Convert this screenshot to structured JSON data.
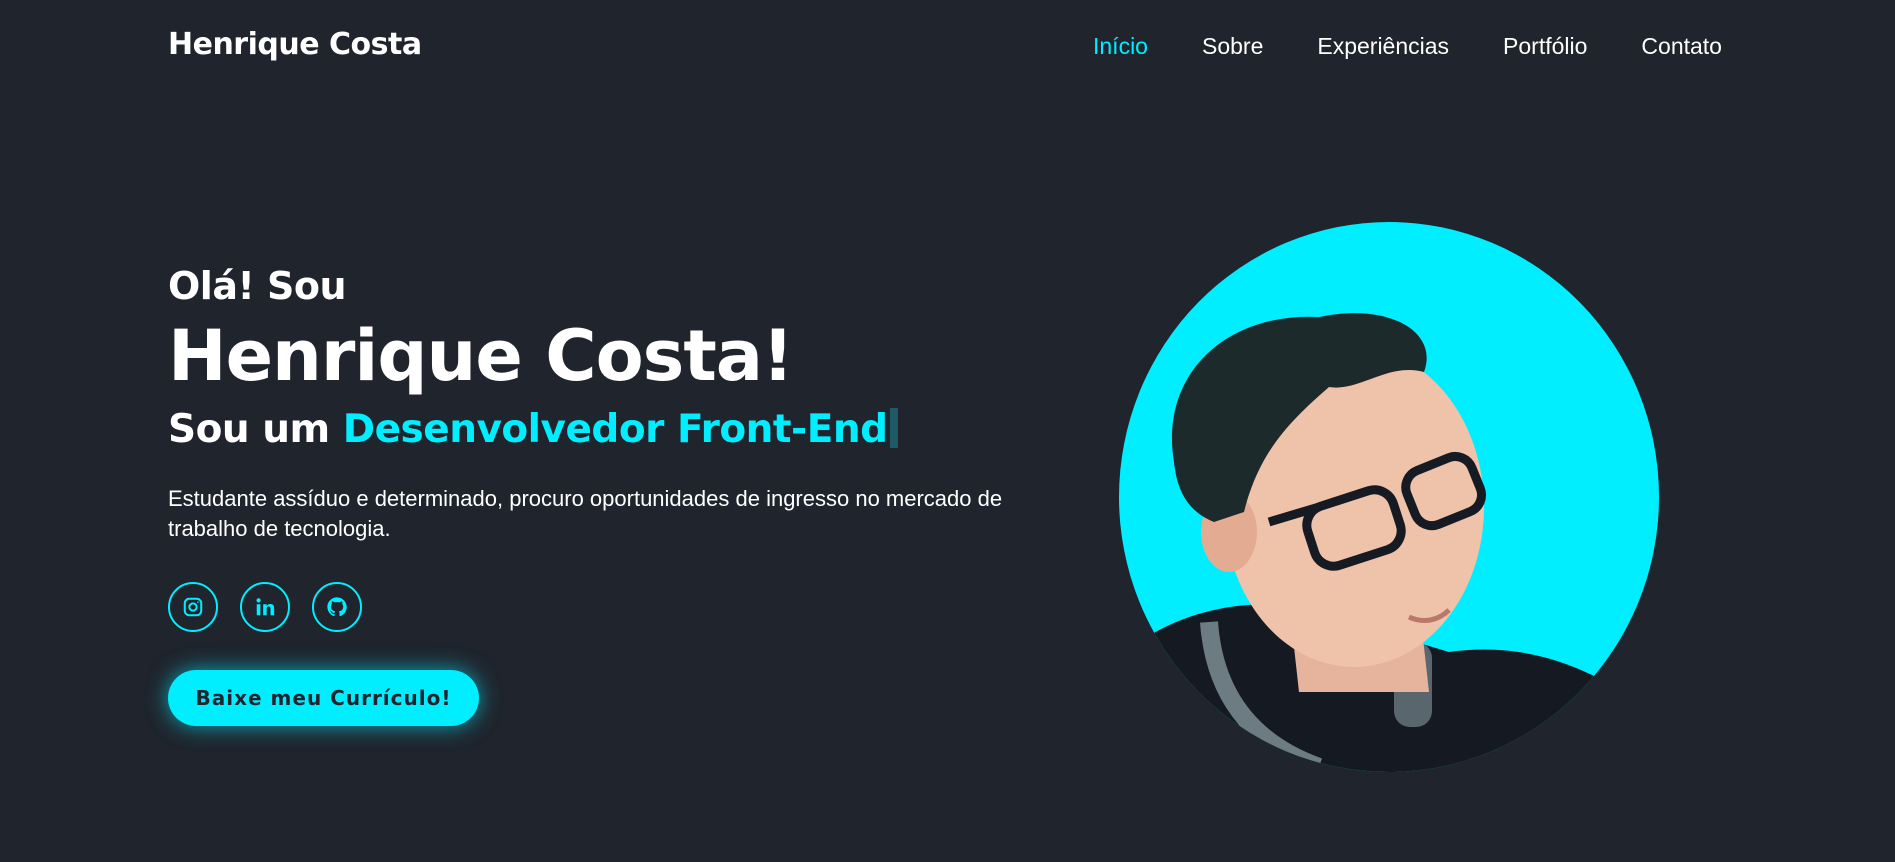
{
  "header": {
    "logo": "Henrique Costa",
    "nav": [
      "Início",
      "Sobre",
      "Experiências",
      "Portfólio",
      "Contato"
    ],
    "active_index": 0
  },
  "hero": {
    "greeting": "Olá! Sou",
    "name": "Henrique Costa!",
    "role_prefix": "Sou um ",
    "role_highlight": "Desenvolvedor Front-End",
    "description": "Estudante assíduo e determinado, procuro oportunidades de ingresso no mercado de trabalho de tecnologia.",
    "socials": [
      {
        "icon": "instagram-icon"
      },
      {
        "icon": "linkedin-icon"
      },
      {
        "icon": "github-icon"
      }
    ],
    "cv_button": "Baixe meu Currículo!"
  },
  "colors": {
    "background": "#1f242d",
    "accent": "#00eeff",
    "text": "#ffffff"
  }
}
